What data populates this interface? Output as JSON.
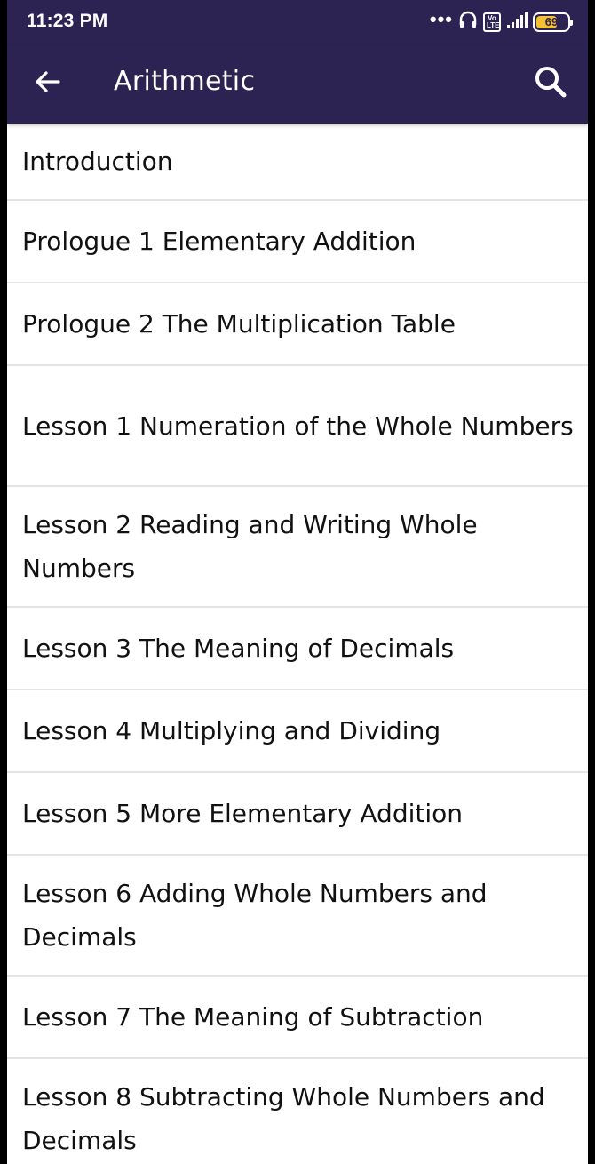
{
  "status_bar": {
    "time": "11:23 PM",
    "dots": "•••",
    "volte": "Vo LTE",
    "battery_level": "69"
  },
  "app_bar": {
    "title": "Arithmetic",
    "back_icon": "arrow-left-icon",
    "search_icon": "search-icon"
  },
  "colors": {
    "app_bar_bg": "#2c2353",
    "battery": "#f2c232"
  },
  "lessons": [
    "Introduction",
    "Prologue 1 Elementary Addition",
    "Prologue 2 The Multiplication Table",
    "Lesson 1 Numeration of the Whole Numbers",
    "Lesson 2 Reading and Writing Whole Numbers",
    "Lesson 3 The Meaning of Decimals",
    "Lesson 4 Multiplying and Dividing",
    "Lesson 5 More Elementary Addition",
    "Lesson 6 Adding Whole Numbers and Decimals",
    "Lesson 7 The Meaning of Subtraction",
    "Lesson 8 Subtracting Whole Numbers and Decimals"
  ]
}
